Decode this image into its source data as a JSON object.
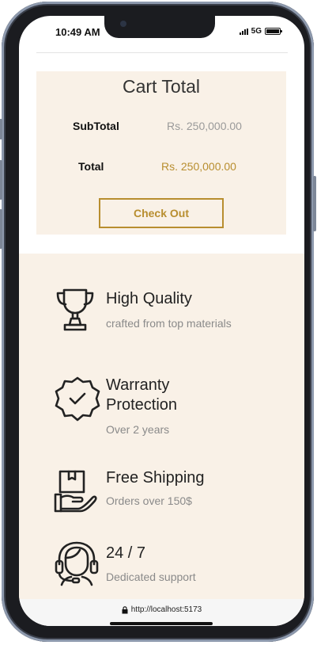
{
  "status_bar": {
    "time": "10:49 AM",
    "network": "5G"
  },
  "cart_totals": {
    "title": "Cart Total",
    "subtotal_label": "SubTotal",
    "subtotal_value": "Rs. 250,000.00",
    "total_label": "Total",
    "total_value": "Rs. 250,000.00",
    "checkout_label": "Check Out"
  },
  "features": [
    {
      "icon": "trophy-icon",
      "title": "High Quality",
      "subtitle": "crafted from top materials"
    },
    {
      "icon": "warranty-badge-icon",
      "title": "Warranty Protection",
      "subtitle": "Over 2 years"
    },
    {
      "icon": "shipping-box-icon",
      "title": "Free Shipping",
      "subtitle": "Orders over 150$"
    },
    {
      "icon": "headset-support-icon",
      "title": "24 / 7",
      "subtitle": "Dedicated support"
    }
  ],
  "browser": {
    "url": "http://localhost:5173"
  },
  "colors": {
    "accent": "#b88e2f",
    "section_bg": "#f9f1e7",
    "subtle_text": "#8a8a8a"
  }
}
